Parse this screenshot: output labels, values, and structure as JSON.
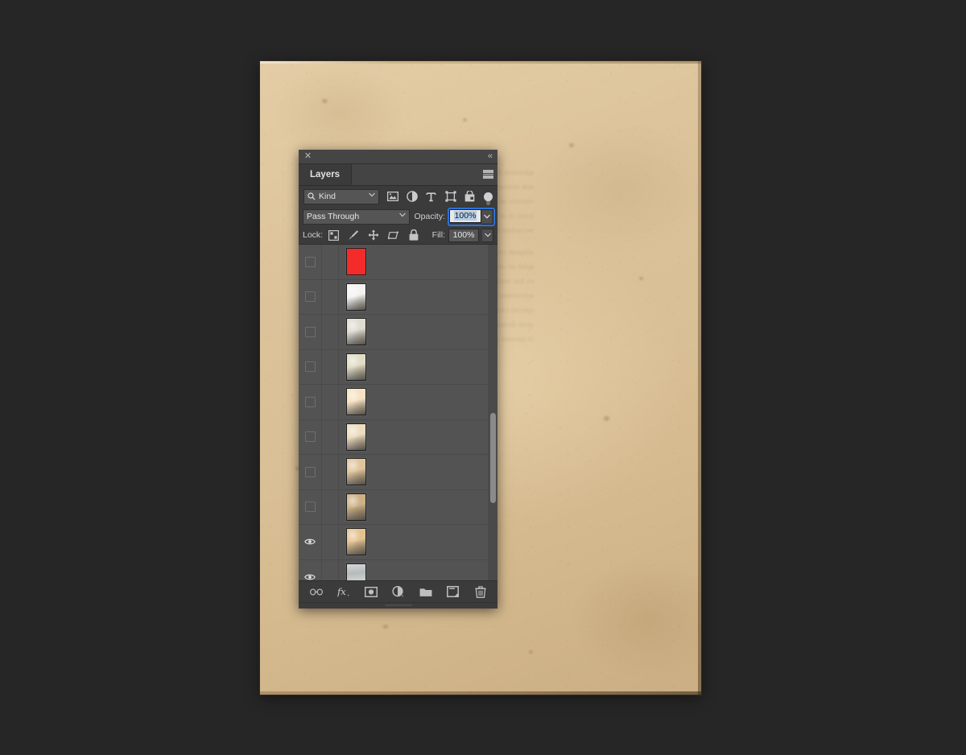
{
  "window": {
    "background_color": "#262626"
  },
  "document": {
    "name": "aged-paper-scan",
    "paper_color": "#dcc39b",
    "ghost_lines": [
      "quondam fuerat ille",
      "non obstante quod",
      "veniens ad illam",
      "habet in se nihil",
      "secundum rationem",
      "",
      "aliquam consequi",
      "quod ad omnia sunt",
      "ex hoc tempore",
      "universum habetur",
      "species cuiusdam est",
      "sicut dictum fuerat",
      "in quorum aliquibus"
    ]
  },
  "panel": {
    "title": "Layers",
    "close_label": "✕",
    "collapse_label": "«",
    "menu_name": "panel-menu-icon",
    "tabs": [
      {
        "label": "Layers",
        "active": true
      }
    ],
    "filter": {
      "search_icon": "search-icon",
      "kind_label": "Kind",
      "caret": "⌄",
      "icons": [
        {
          "name": "pixel-layer-filter-icon",
          "title": "Filter for pixel layers"
        },
        {
          "name": "adjustment-layer-filter-icon",
          "title": "Filter for adjustment layers"
        },
        {
          "name": "type-layer-filter-icon",
          "title": "Filter for type layers"
        },
        {
          "name": "shape-layer-filter-icon",
          "title": "Filter for shape layers"
        },
        {
          "name": "smart-object-filter-icon",
          "title": "Filter for smart objects"
        }
      ],
      "toggle_name": "filter-enable-toggle",
      "toggle_on": false
    },
    "blend": {
      "mode": "Pass Through",
      "caret": "⌄",
      "opacity_label": "Opacity:",
      "opacity_value": "100%",
      "opacity_focused": true,
      "opacity_focus_color": "#2b73d8",
      "opacity_selection_color": "#b4cde8"
    },
    "lock": {
      "label": "Lock:",
      "icons": [
        {
          "name": "lock-transparent-pixels-icon",
          "title": "Lock transparent pixels"
        },
        {
          "name": "lock-image-pixels-icon",
          "title": "Lock image pixels"
        },
        {
          "name": "lock-position-icon",
          "title": "Lock position"
        },
        {
          "name": "lock-artboard-nesting-icon",
          "title": "Prevent auto-nesting"
        },
        {
          "name": "lock-all-icon",
          "title": "Lock all"
        }
      ],
      "fill_label": "Fill:",
      "fill_value": "100%",
      "fill_caret": "⌄"
    },
    "layers": [
      {
        "index": 1,
        "visible": false,
        "thumb_type": "solid",
        "thumb_color": "#f32b2b",
        "name": "layer-thumbnail-red"
      },
      {
        "index": 2,
        "visible": false,
        "thumb_type": "paper",
        "thumb_color": "#f4f3f0",
        "name": "layer-thumbnail-white-streaked"
      },
      {
        "index": 3,
        "visible": false,
        "thumb_type": "paper",
        "thumb_color": "#dedbd0",
        "name": "layer-thumbnail-pale-gray"
      },
      {
        "index": 4,
        "visible": false,
        "thumb_type": "paper",
        "thumb_color": "#e2dcc4",
        "name": "layer-thumbnail-cream"
      },
      {
        "index": 5,
        "visible": false,
        "thumb_type": "paper",
        "thumb_color": "#f6e2c2",
        "name": "layer-thumbnail-light-cream"
      },
      {
        "index": 6,
        "visible": false,
        "thumb_type": "paper",
        "thumb_color": "#eddcbe",
        "name": "layer-thumbnail-tan-cream"
      },
      {
        "index": 7,
        "visible": false,
        "thumb_type": "paper",
        "thumb_color": "#e0c49a",
        "name": "layer-thumbnail-tan"
      },
      {
        "index": 8,
        "visible": false,
        "thumb_type": "paper",
        "thumb_color": "#cdb084",
        "name": "layer-thumbnail-mottled-tan"
      },
      {
        "index": 9,
        "visible": true,
        "thumb_type": "paper",
        "thumb_color": "#e5c391",
        "name": "layer-thumbnail-tan-plain"
      },
      {
        "index": 10,
        "visible": true,
        "thumb_type": "gray",
        "thumb_color": "#b9bcbc",
        "name": "layer-thumbnail-gray-partial"
      }
    ],
    "scrollbar": {
      "thumb_top_pct": 50,
      "thumb_height_pct": 27
    },
    "footer_icons": [
      {
        "name": "link-layers-icon",
        "title": "Link layers"
      },
      {
        "name": "layer-style-fx-icon",
        "title": "Add a layer style"
      },
      {
        "name": "add-layer-mask-icon",
        "title": "Add layer mask"
      },
      {
        "name": "adjustment-layer-icon",
        "title": "Create new fill or adjustment layer"
      },
      {
        "name": "new-group-icon",
        "title": "Create a new group"
      },
      {
        "name": "new-layer-icon",
        "title": "Create a new layer"
      },
      {
        "name": "delete-layer-icon",
        "title": "Delete layer"
      }
    ]
  }
}
